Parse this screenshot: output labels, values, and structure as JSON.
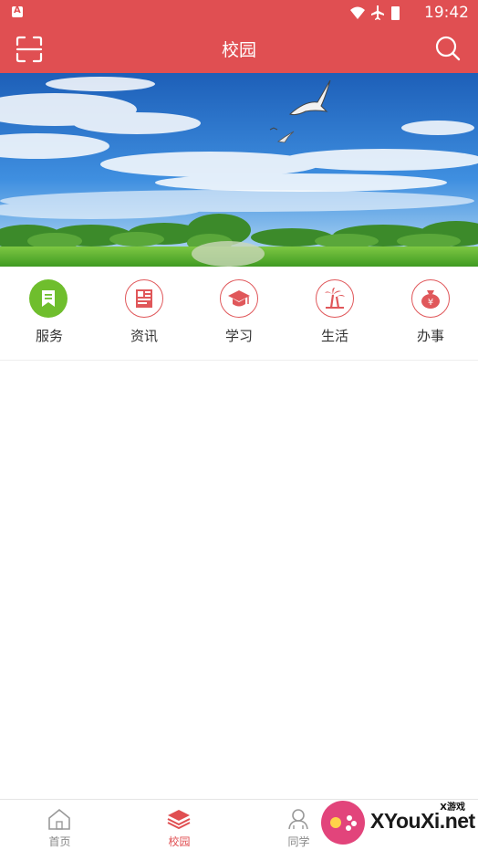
{
  "status_bar": {
    "time": "19:42"
  },
  "app_bar": {
    "title": "校园"
  },
  "quick_links": [
    {
      "label": "服务",
      "icon": "bookmark-icon"
    },
    {
      "label": "资讯",
      "icon": "news-icon"
    },
    {
      "label": "学习",
      "icon": "graduation-cap-icon"
    },
    {
      "label": "生活",
      "icon": "palm-tree-icon"
    },
    {
      "label": "办事",
      "icon": "money-bag-icon"
    }
  ],
  "tab_bar": [
    {
      "label": "首页",
      "icon": "home-icon",
      "active": false
    },
    {
      "label": "校园",
      "icon": "layers-icon",
      "active": true
    },
    {
      "label": "同学",
      "icon": "classmates-icon",
      "active": false
    }
  ],
  "watermark": {
    "brand": "XYouXi.net",
    "small": "X游戏"
  },
  "colors": {
    "accent": "#e04f52",
    "service_green": "#6fbe2d"
  }
}
